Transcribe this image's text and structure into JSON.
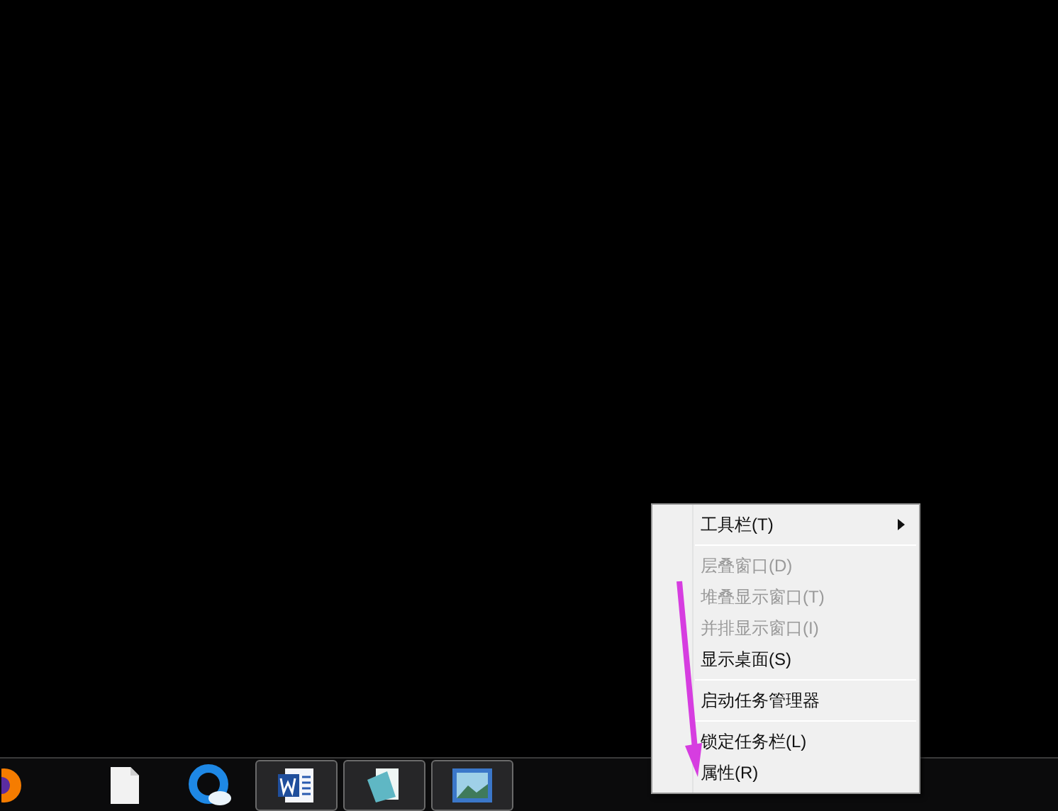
{
  "taskbar": {
    "apps": [
      {
        "kind": "browser",
        "running": false
      },
      {
        "kind": "file",
        "running": false
      },
      {
        "kind": "cloud",
        "running": false
      },
      {
        "kind": "word",
        "running": true
      },
      {
        "kind": "notepad",
        "running": true
      },
      {
        "kind": "photo",
        "running": true
      }
    ]
  },
  "context_menu": {
    "items": [
      {
        "kind": "item",
        "label": "工具栏(T)",
        "disabled": false,
        "submenu": true
      },
      {
        "kind": "separator"
      },
      {
        "kind": "item",
        "label": "层叠窗口(D)",
        "disabled": true,
        "submenu": false
      },
      {
        "kind": "item",
        "label": "堆叠显示窗口(T)",
        "disabled": true,
        "submenu": false
      },
      {
        "kind": "item",
        "label": "并排显示窗口(I)",
        "disabled": true,
        "submenu": false
      },
      {
        "kind": "item",
        "label": "显示桌面(S)",
        "disabled": false,
        "submenu": false
      },
      {
        "kind": "separator"
      },
      {
        "kind": "item",
        "label": "启动任务管理器",
        "disabled": false,
        "submenu": false
      },
      {
        "kind": "separator"
      },
      {
        "kind": "item",
        "label": "锁定任务栏(L)",
        "disabled": false,
        "submenu": false
      },
      {
        "kind": "item",
        "label": "属性(R)",
        "disabled": false,
        "submenu": false
      }
    ]
  }
}
